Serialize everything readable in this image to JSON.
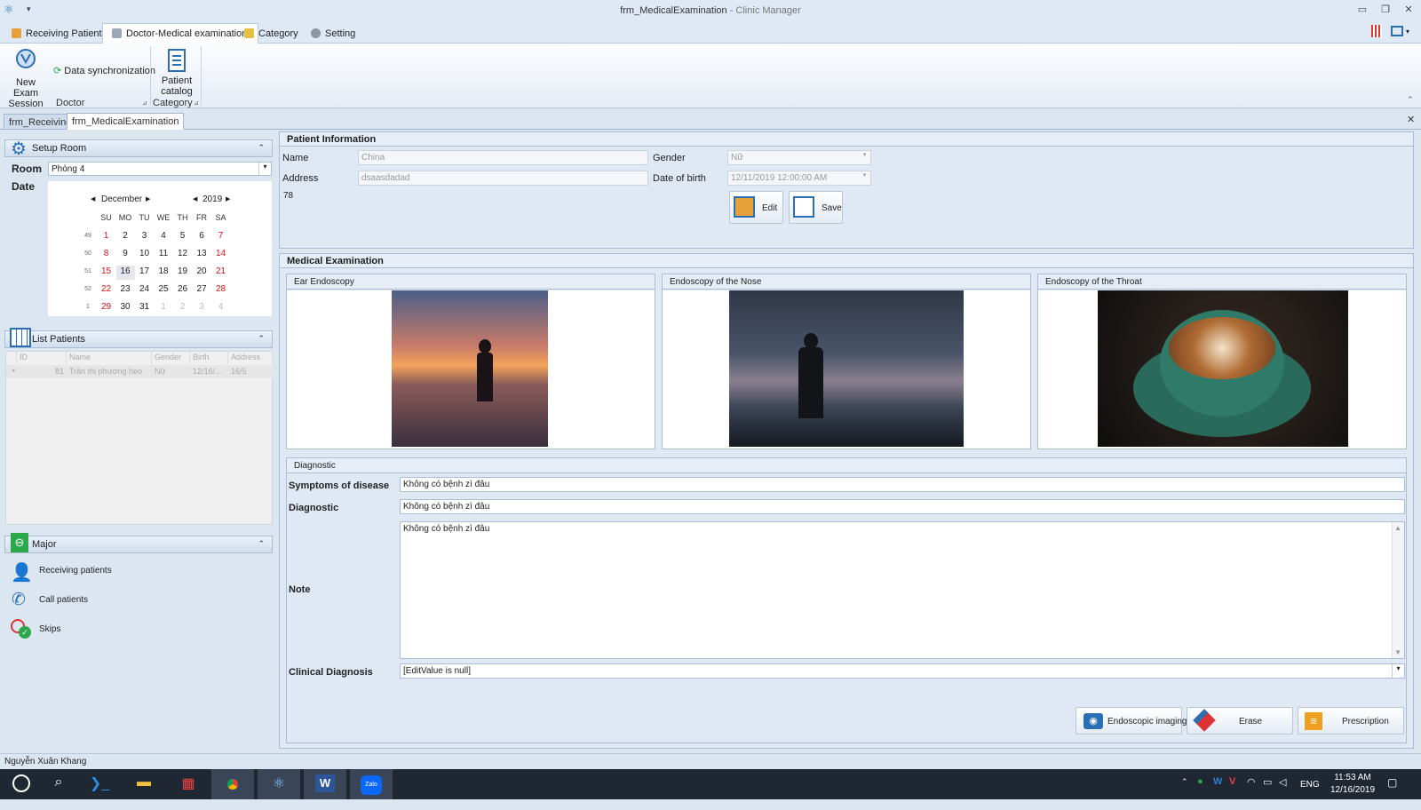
{
  "window": {
    "title": "frm_MedicalExamination",
    "app": "Clinic Manager",
    "separator": " - "
  },
  "ribbon_tabs": [
    {
      "label": "Receiving Patients"
    },
    {
      "label": "Doctor-Medical examination"
    },
    {
      "label": "Category"
    },
    {
      "label": "Setting"
    }
  ],
  "ribbon": {
    "new_exam": "New Exam Session",
    "data_sync": "Data synchronization",
    "doctor_group": "Doctor",
    "patient_catalog": "Patient catalog",
    "category_group": "Category"
  },
  "doc_tabs": [
    {
      "label": "frm_Receiving"
    },
    {
      "label": "frm_MedicalExamination"
    }
  ],
  "setup_room": {
    "header": "Setup Room",
    "room_label": "Room",
    "room_value": "Phòng 4",
    "date_label": "Date"
  },
  "calendar": {
    "month": "December",
    "year": "2019",
    "days": [
      "SU",
      "MO",
      "TU",
      "WE",
      "TH",
      "FR",
      "SA"
    ],
    "weeks": [
      {
        "wk": "49",
        "d": [
          "1",
          "2",
          "3",
          "4",
          "5",
          "6",
          "7"
        ]
      },
      {
        "wk": "50",
        "d": [
          "8",
          "9",
          "10",
          "11",
          "12",
          "13",
          "14"
        ]
      },
      {
        "wk": "51",
        "d": [
          "15",
          "16",
          "17",
          "18",
          "19",
          "20",
          "21"
        ]
      },
      {
        "wk": "52",
        "d": [
          "22",
          "23",
          "24",
          "25",
          "26",
          "27",
          "28"
        ]
      },
      {
        "wk": "1",
        "d": [
          "29",
          "30",
          "31",
          "1",
          "2",
          "3",
          "4"
        ]
      }
    ],
    "selected": "16"
  },
  "list_patients": {
    "header": "List Patients",
    "columns": [
      "ID",
      "Name",
      "Gender",
      "Birth",
      "Address"
    ],
    "rows": [
      [
        "81",
        "Trần thị phương heo",
        "Nữ",
        "12/16/...",
        "16/5"
      ]
    ]
  },
  "major": {
    "header": "Major",
    "items": [
      "Receiving patients",
      "Call patients",
      "Skips"
    ]
  },
  "patient_info": {
    "header": "Patient Information",
    "name_label": "Name",
    "name_value": "China",
    "gender_label": "Gender",
    "gender_value": "Nữ",
    "address_label": "Address",
    "address_value": "dsaasdadad",
    "dob_label": "Date of birth",
    "dob_value": "12/11/2019 12:00:00 AM",
    "extra": "78",
    "edit": "Edit",
    "save": "Save"
  },
  "exam": {
    "header": "Medical Examination",
    "ear": "Ear Endoscopy",
    "nose": "Endoscopy of the Nose",
    "throat": "Endoscopy of the Throat"
  },
  "diagnostic": {
    "header": "Diagnostic",
    "symptoms_label": "Symptoms of disease",
    "symptoms_value": "Không có bệnh zì đâu",
    "diag_label": "Diagnostic",
    "diag_value": "Không có bệnh zì đâu",
    "note_label": "Note",
    "note_value": "Không có bệnh zì đâu",
    "clinical_label": "Clinical Diagnosis",
    "clinical_value": "[EditValue is null]"
  },
  "actions": {
    "imaging": "Endoscopic imaging",
    "erase": "Erase",
    "prescription": "Prescription"
  },
  "status": {
    "user": "Nguyễn Xuân Khang"
  },
  "tray": {
    "lang": "ENG",
    "time": "11:53 AM",
    "date": "12/16/2019"
  },
  "colors": {
    "accent": "#2a6fb5",
    "weekend": "#dd1111",
    "taskbar": "#1f2733"
  }
}
